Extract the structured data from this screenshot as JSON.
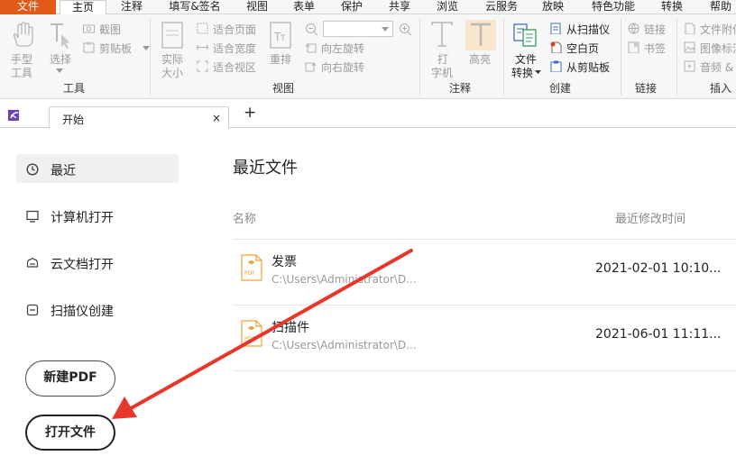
{
  "menu": {
    "file": "文件",
    "items": [
      "主页",
      "注释",
      "填写&签名",
      "视图",
      "表单",
      "保护",
      "共享",
      "浏览",
      "云服务",
      "放映",
      "特色功能",
      "转换",
      "帮助"
    ]
  },
  "ribbon": {
    "tools_group": {
      "hand": "手型\n工具",
      "hand_l1": "手型",
      "hand_l2": "工具",
      "select_l1": "选择",
      "screenshot": "截图",
      "clipboard": "剪贴板",
      "label": "工具"
    },
    "view_group": {
      "actual_l1": "实际",
      "actual_l2": "大小",
      "fit_page": "适合页面",
      "fit_width": "适合宽度",
      "fit_area": "适合视区",
      "reflow": "重排",
      "rotate_left": "向左旋转",
      "rotate_right": "向右旋转",
      "label": "视图"
    },
    "annot_group": {
      "typewriter_l1": "打",
      "typewriter_l2": "字机",
      "highlight": "高亮",
      "label": "注释"
    },
    "create_group": {
      "convert_l1": "文件",
      "convert_l2": "转换",
      "from_scanner": "从扫描仪",
      "blank": "空白页",
      "from_clipboard": "从剪贴板",
      "label": "创建"
    },
    "link_group": {
      "link": "链接",
      "bookmark": "书签",
      "label": "链接"
    },
    "insert_group": {
      "attachment": "文件附件",
      "image_annot": "图像标注",
      "audio": "音频 &",
      "label": "插入"
    }
  },
  "tabs": {
    "active_label": "开始",
    "close": "×",
    "add": "+"
  },
  "nav": {
    "items": [
      {
        "label": "最近",
        "icon": "clock-icon"
      },
      {
        "label": "计算机打开",
        "icon": "monitor-icon"
      },
      {
        "label": "云文档打开",
        "icon": "cloud-drive-icon"
      },
      {
        "label": "扫描仪创建",
        "icon": "scanner-icon"
      }
    ],
    "new_pdf": "新建PDF",
    "open_file": "打开文件"
  },
  "recent": {
    "title": "最近文件",
    "col_name": "名称",
    "col_time": "最近修改时间",
    "files": [
      {
        "name": "发票",
        "path": "C:\\Users\\Administrator\\D...",
        "time": "2021-02-01 10:10..."
      },
      {
        "name": "扫描件",
        "path": "C:\\Users\\Administrator\\D...",
        "time": "2021-06-01 11:11..."
      }
    ]
  },
  "colors": {
    "brand_orange": "#e25a18",
    "annotation_arrow": "#e8372a",
    "pdf_icon": "#f0a030"
  }
}
